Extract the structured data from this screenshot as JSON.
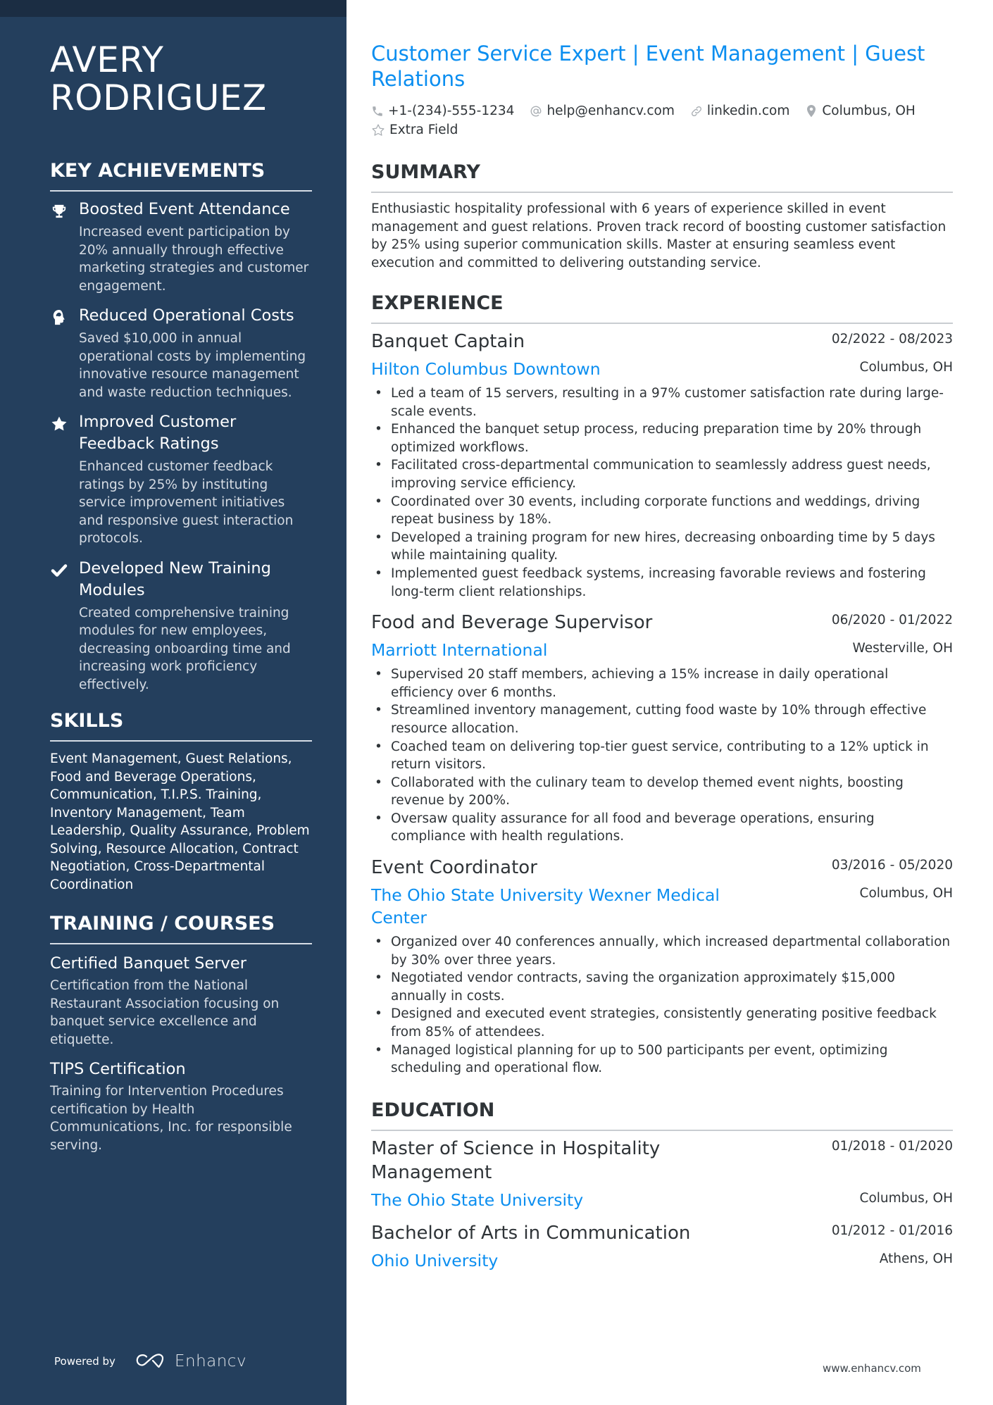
{
  "name": {
    "line1": "AVERY",
    "line2": "RODRIGUEZ"
  },
  "headline": "Customer Service Expert | Event Management | Guest Relations",
  "contacts": [
    {
      "icon": "phone-icon",
      "text": "+1-(234)-555-1234"
    },
    {
      "icon": "at-icon",
      "text": "help@enhancv.com"
    },
    {
      "icon": "link-icon",
      "text": "linkedin.com"
    },
    {
      "icon": "location-pin-icon",
      "text": "Columbus, OH"
    },
    {
      "icon": "star-outline-icon",
      "text": "Extra Field"
    }
  ],
  "sidebar": {
    "achievements_title": "KEY ACHIEVEMENTS",
    "achievements": [
      {
        "icon": "trophy-icon",
        "title": "Boosted Event Attendance",
        "desc": "Increased event participation by 20% annually through effective marketing strategies and customer engagement."
      },
      {
        "icon": "brain-head-icon",
        "title": "Reduced Operational Costs",
        "desc": "Saved $10,000 in annual operational costs by implementing innovative resource management and waste reduction techniques."
      },
      {
        "icon": "star-icon",
        "title": "Improved Customer Feedback Ratings",
        "desc": "Enhanced customer feedback ratings by 25% by instituting service improvement initiatives and responsive guest interaction protocols."
      },
      {
        "icon": "checkmark-icon",
        "title": "Developed New Training Modules",
        "desc": "Created comprehensive training modules for new employees, decreasing onboarding time and increasing work proficiency effectively."
      }
    ],
    "skills_title": "SKILLS",
    "skills_text": "Event Management, Guest Relations, Food and Beverage Operations, Communication, T.I.P.S. Training, Inventory Management, Team Leadership, Quality Assurance, Problem Solving, Resource Allocation, Contract Negotiation, Cross-Departmental Coordination",
    "training_title": "TRAINING / COURSES",
    "courses": [
      {
        "title": "Certified Banquet Server",
        "desc": "Certification from the National Restaurant Association focusing on banquet service excellence and etiquette."
      },
      {
        "title": "TIPS Certification",
        "desc": "Training for Intervention Procedures certification by Health Communications, Inc. for responsible serving."
      }
    ],
    "powered_by": "Powered by",
    "brand": "Enhancv"
  },
  "summary": {
    "title": "SUMMARY",
    "text": "Enthusiastic hospitality professional with 6 years of experience skilled in event management and guest relations. Proven track record of boosting customer satisfaction by 25% using superior communication skills. Master at ensuring seamless event execution and committed to delivering outstanding service."
  },
  "experience": {
    "title": "EXPERIENCE",
    "jobs": [
      {
        "role": "Banquet Captain",
        "dates": "02/2022 - 08/2023",
        "company": "Hilton Columbus Downtown",
        "location": "Columbus, OH",
        "bullets": [
          "Led a team of 15 servers, resulting in a 97% customer satisfaction rate during large-scale events.",
          "Enhanced the banquet setup process, reducing preparation time by 20% through optimized workflows.",
          "Facilitated cross-departmental communication to seamlessly address guest needs, improving service efficiency.",
          "Coordinated over 30 events, including corporate functions and weddings, driving repeat business by 18%.",
          "Developed a training program for new hires, decreasing onboarding time by 5 days while maintaining quality.",
          "Implemented guest feedback systems, increasing favorable reviews and fostering long-term client relationships."
        ]
      },
      {
        "role": "Food and Beverage Supervisor",
        "dates": "06/2020 - 01/2022",
        "company": "Marriott International",
        "location": "Westerville, OH",
        "bullets": [
          "Supervised 20 staff members, achieving a 15% increase in daily operational efficiency over 6 months.",
          "Streamlined inventory management, cutting food waste by 10% through effective resource allocation.",
          "Coached team on delivering top-tier guest service, contributing to a 12% uptick in return visitors.",
          "Collaborated with the culinary team to develop themed event nights, boosting revenue by 200%.",
          "Oversaw quality assurance for all food and beverage operations, ensuring compliance with health regulations."
        ]
      },
      {
        "role": "Event Coordinator",
        "dates": "03/2016 - 05/2020",
        "company": "The Ohio State University Wexner Medical Center",
        "location": "Columbus, OH",
        "bullets": [
          "Organized over 40 conferences annually, which increased departmental collaboration by 30% over three years.",
          "Negotiated vendor contracts, saving the organization approximately $15,000 annually in costs.",
          "Designed and executed event strategies, consistently generating positive feedback from 85% of attendees.",
          "Managed logistical planning for up to 500 participants per event, optimizing scheduling and operational flow."
        ]
      }
    ]
  },
  "education": {
    "title": "EDUCATION",
    "items": [
      {
        "degree": "Master of Science in Hospitality Management",
        "dates": "01/2018 - 01/2020",
        "school": "The Ohio State University",
        "location": "Columbus, OH"
      },
      {
        "degree": "Bachelor of Arts in Communication",
        "dates": "01/2012 - 01/2016",
        "school": "Ohio University",
        "location": "Athens, OH"
      }
    ]
  },
  "footer_url": "www.enhancv.com",
  "colors": {
    "sidebar_bg": "#243f5d",
    "accent": "#0b8ef0",
    "text": "#2f3438"
  }
}
